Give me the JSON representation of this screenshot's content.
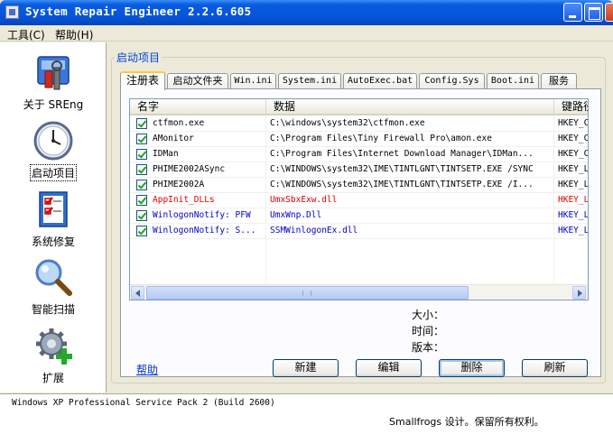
{
  "window": {
    "title": "System Repair Engineer 2.2.6.605"
  },
  "menu": {
    "items": [
      {
        "label": "工具(C)"
      },
      {
        "label": "帮助(H)"
      }
    ]
  },
  "sidebar": {
    "items": [
      {
        "label": "关于 SREng",
        "icon": "toolbox-icon"
      },
      {
        "label": "启动项目",
        "icon": "clock-icon",
        "active": true
      },
      {
        "label": "系统修复",
        "icon": "checklist-icon"
      },
      {
        "label": "智能扫描",
        "icon": "magnifier-icon"
      },
      {
        "label": "扩展",
        "icon": "gear-plus-icon"
      }
    ]
  },
  "main": {
    "group_title": "启动项目",
    "tabs": [
      {
        "label": "注册表",
        "active": true
      },
      {
        "label": "启动文件夹"
      },
      {
        "label": "Win.ini"
      },
      {
        "label": "System.ini"
      },
      {
        "label": "AutoExec.bat"
      },
      {
        "label": "Config.Sys"
      },
      {
        "label": "Boot.ini"
      },
      {
        "label": "服务"
      }
    ],
    "list": {
      "columns": [
        "名字",
        "数据",
        "键路径"
      ],
      "rows": [
        {
          "checked": true,
          "name": "ctfmon.exe",
          "data": "C:\\windows\\system32\\ctfmon.exe",
          "key": "HKEY_CURRENT_USER",
          "color": "normal"
        },
        {
          "checked": true,
          "name": "AMonitor",
          "data": "C:\\Program Files\\Tiny Firewall Pro\\amon.exe",
          "key": "HKEY_CURRENT_USER",
          "color": "normal"
        },
        {
          "checked": true,
          "name": "IDMan",
          "data": "C:\\Program Files\\Internet Download Manager\\IDMan...",
          "key": "HKEY_CURRENT_USER",
          "color": "normal"
        },
        {
          "checked": true,
          "name": "PHIME2002ASync",
          "data": "C:\\WINDOWS\\system32\\IME\\TINTLGNT\\TINTSETP.EXE /SYNC",
          "key": "HKEY_LOCAL_MACHINE",
          "color": "normal"
        },
        {
          "checked": true,
          "name": "PHIME2002A",
          "data": "C:\\WINDOWS\\system32\\IME\\TINTLGNT\\TINTSETP.EXE /I...",
          "key": "HKEY_LOCAL_MACHINE",
          "color": "normal"
        },
        {
          "checked": true,
          "name": "AppInit_DLLs",
          "data": "UmxSbxExw.dll",
          "key": "HKEY_LOCAL_MACHINE",
          "color": "red"
        },
        {
          "checked": true,
          "name": "WinlogonNotify: PFW",
          "data": "UmxWnp.Dll",
          "key": "HKEY_LOCAL_MACHINE",
          "color": "blue"
        },
        {
          "checked": true,
          "name": "WinlogonNotify: S...",
          "data": "SSMWinlogonEx.dll",
          "key": "HKEY_LOCAL_MACHINE",
          "color": "blue"
        }
      ]
    },
    "info": {
      "size_label": "大小：",
      "time_label": "时间：",
      "version_label": "版本："
    },
    "help_label": "帮助",
    "buttons": {
      "new": "新建",
      "edit": "编辑",
      "delete": "删除",
      "refresh": "刷新"
    }
  },
  "statusbar": {
    "os": "Windows XP Professional Service Pack 2 (Build 2600)",
    "copyright": "Smallfrogs 设计。保留所有权利。"
  },
  "colors": {
    "titlebar": "#0553d9",
    "group_title": "#0046d5",
    "highlight_red": "#e00000",
    "highlight_blue": "#0000cc",
    "check_green": "#21a121"
  }
}
